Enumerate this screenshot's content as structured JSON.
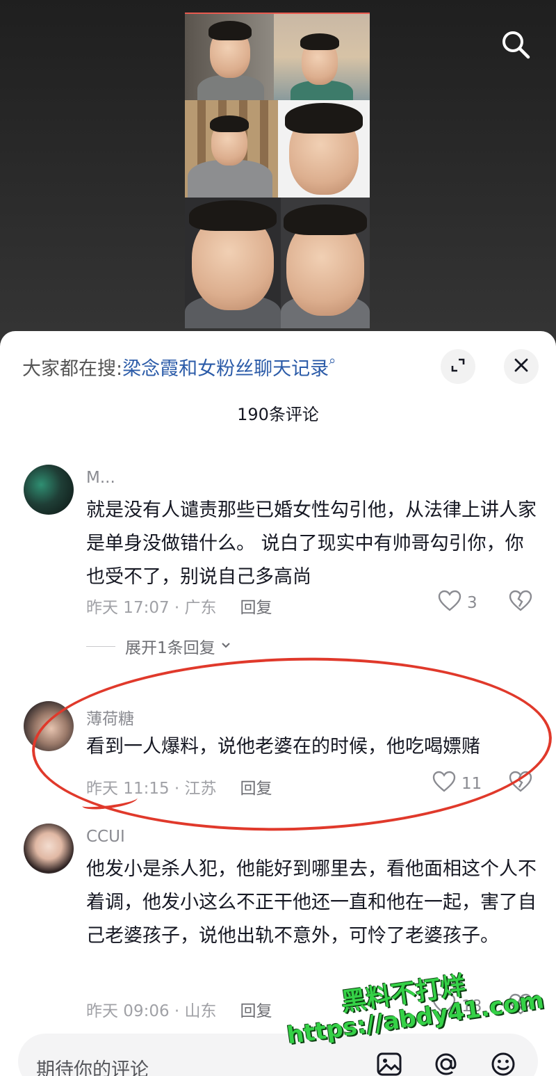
{
  "video": {
    "icons": {
      "search": "search-icon"
    }
  },
  "panel": {
    "search_hint": {
      "prefix": "大家都在搜:",
      "query": "梁念霞和女粉丝聊天记录",
      "icon": "search-small-icon"
    },
    "comment_count": "190条评论",
    "icons": {
      "expand": "expand-icon",
      "close": "close-icon"
    }
  },
  "comments": [
    {
      "username": "M...",
      "text": "就是没有人谴责那些已婚女性勾引他，从法律上讲人家是单身没做错什么。 说白了现实中有帅哥勾引你，你也受不了，别说自己多高尚",
      "time_location": "昨天 17:07 · 广东",
      "reply_label": "回复",
      "likes": "3",
      "expand_replies": "展开1条回复"
    },
    {
      "username": "薄荷糖",
      "text": "看到一人爆料，说他老婆在的时候，他吃喝嫖赌",
      "time_location": "昨天 11:15 · 江苏",
      "reply_label": "回复",
      "likes": "11"
    },
    {
      "username": "CCUI",
      "text": "他发小是杀人犯，他能好到哪里去，看他面相这个人不着调，他发小这么不正干他还一直和他在一起，害了自己老婆孩子，说他出轨不意外，可怜了老婆孩子。",
      "time_location": "昨天 09:06 · 山东",
      "reply_label": "回复",
      "likes": "18"
    }
  ],
  "input": {
    "placeholder": "期待你的评论",
    "icons": [
      "image-icon",
      "at-icon",
      "emoji-icon"
    ]
  },
  "watermark": {
    "line1": "黑料不打烊",
    "line2": "https://abdy41.com"
  },
  "colors": {
    "link": "#2b5ba8",
    "highlight_circle": "#e0392b",
    "watermark": "#35d147"
  }
}
